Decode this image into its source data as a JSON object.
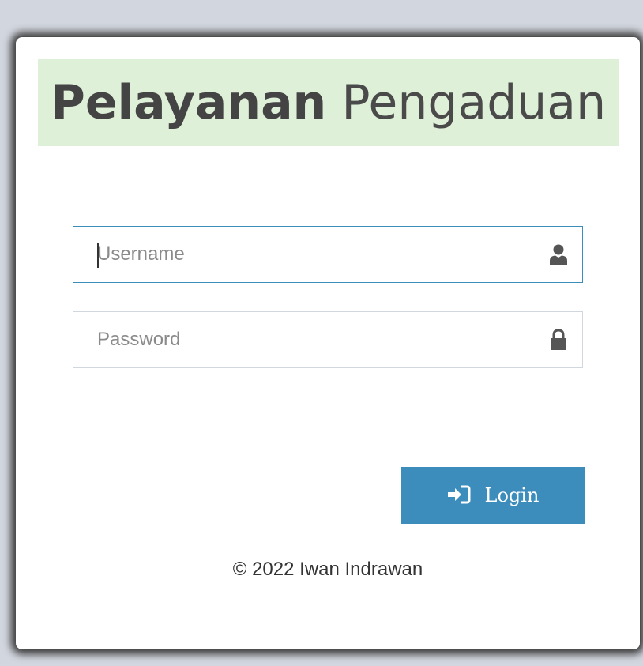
{
  "app": {
    "title_bold": "Pelayanan",
    "title_light": "Pengaduan"
  },
  "form": {
    "username": {
      "value": "",
      "placeholder": "Username",
      "icon": "user-icon"
    },
    "password": {
      "value": "",
      "placeholder": "Password",
      "icon": "lock-icon"
    },
    "login_button": {
      "label": "Login",
      "icon": "sign-in-icon"
    }
  },
  "footer": {
    "copyright": "© 2022 Iwan Indrawan"
  },
  "colors": {
    "accent": "#3c8dbc",
    "banner_bg": "#dff0d8",
    "page_bg": "#d2d6de",
    "icon": "#555555"
  }
}
